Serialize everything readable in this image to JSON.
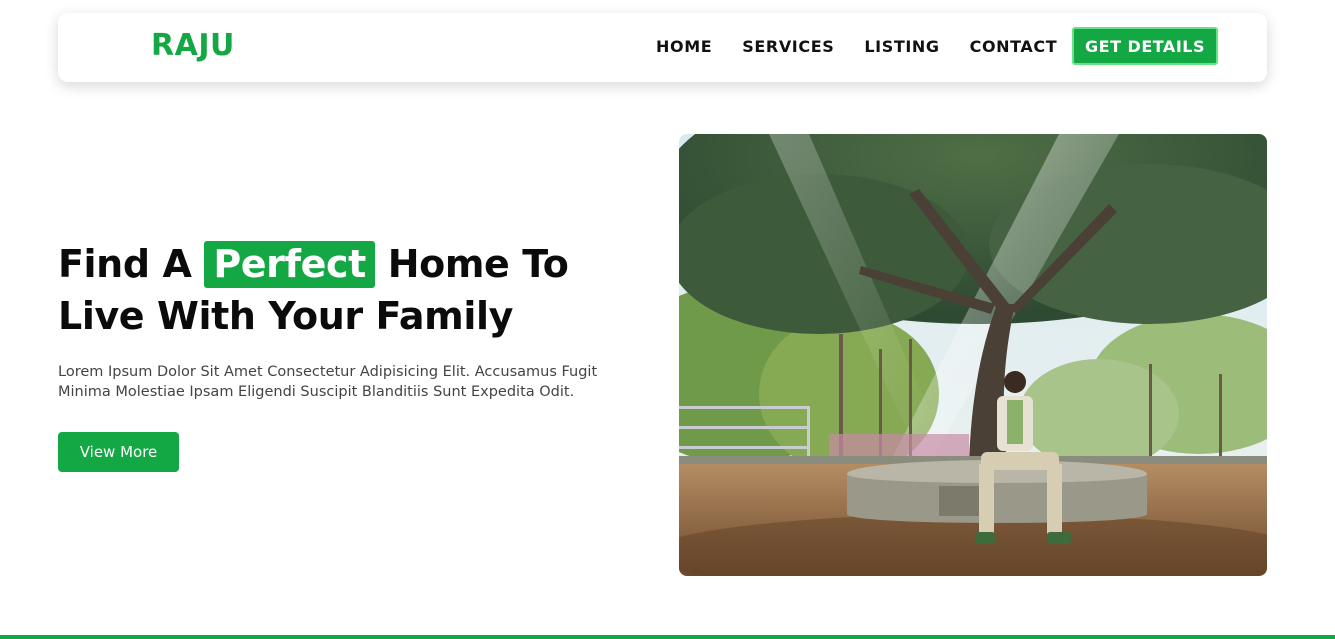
{
  "brand": {
    "logo": "RAJU"
  },
  "nav": {
    "links": [
      "HOME",
      "SERVICES",
      "LISTING",
      "CONTACT"
    ],
    "cta": "GET DETAILS"
  },
  "hero": {
    "title_before": "Find A",
    "title_highlight": "Perfect",
    "title_after": "Home To Live With Your Family",
    "description": "Lorem Ipsum Dolor Sit Amet Consectetur Adipisicing Elit. Accusamus Fugit Minima Molestiae Ipsam Eligendi Suscipit Blanditiis Sunt Expedita Odit.",
    "button": "View More"
  },
  "colors": {
    "accent": "#14a845",
    "text_dark": "#0b0b0b",
    "text_muted": "#444444"
  }
}
